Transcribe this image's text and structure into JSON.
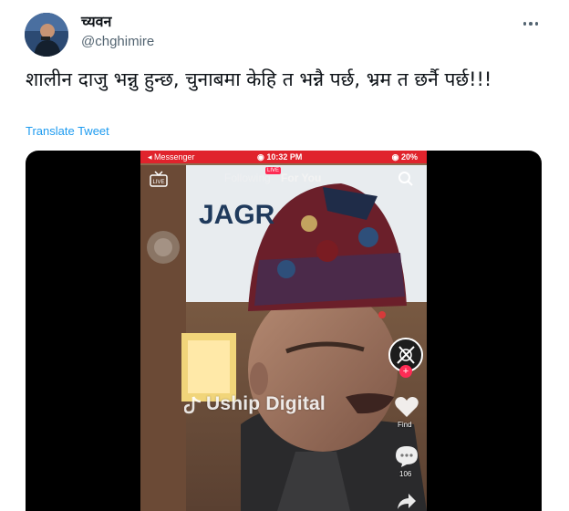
{
  "author": {
    "display_name": "च्यवन",
    "handle": "@chghimire"
  },
  "tweet": {
    "text": "शालीन दाजु भन्नु हुन्छ, चुनाबमा केहि त भन्नै पर्छ, भ्रम त छर्नै पर्छ!!!",
    "translate_label": "Translate Tweet"
  },
  "video": {
    "status_app": "◂ Messenger",
    "status_time": "◉ 10:32 PM",
    "status_battery": "◉ 20%",
    "tab_following": "Following",
    "tab_for_you": "For You",
    "live_badge": "LIVE",
    "background_sign": "JAGR",
    "watermark": "Uship Digital",
    "like_count": "Find",
    "comment_count": "106"
  },
  "colors": {
    "link": "#1d9bf0",
    "text": "#0f1419",
    "secondary": "#536471",
    "tiktok_red": "#fe2c55",
    "status_red": "#e0232c"
  },
  "icons": [
    "more-options-icon",
    "live-tv-icon",
    "search-icon",
    "heart-icon",
    "comment-icon",
    "share-icon",
    "add-follow-icon"
  ]
}
